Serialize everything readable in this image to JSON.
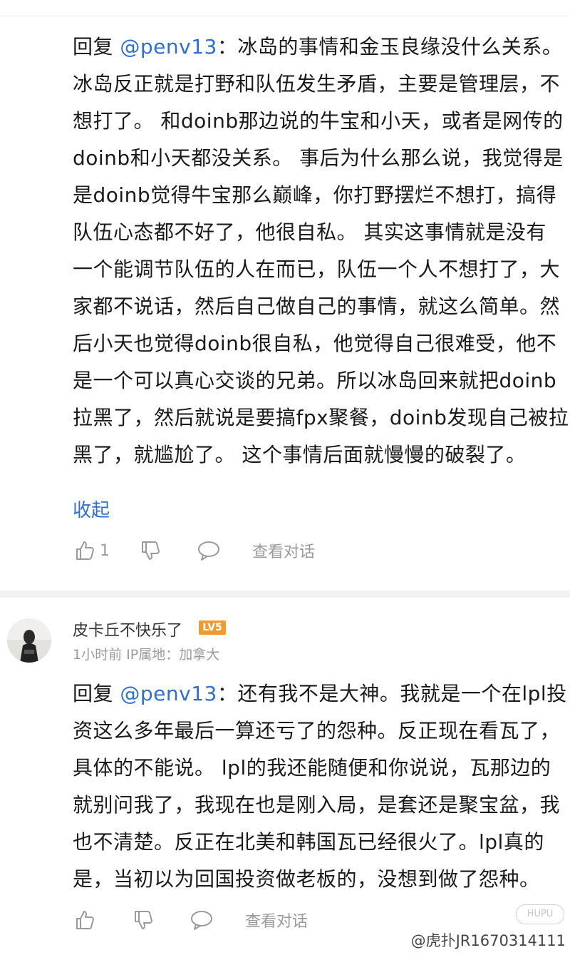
{
  "first_comment": {
    "lines": [
      {
        "pre": "回复 ",
        "mention": "@penv13",
        "post": "：冰岛的事情和金玉良缘没什么关系。"
      },
      {
        "pre": "冰岛反正就是打野和队伍发生矛盾，主要是管理层，不",
        "mention": "",
        "post": ""
      },
      {
        "pre": "想打了。 和doinb那边说的牛宝和小天，或者是网传的",
        "mention": "",
        "post": ""
      },
      {
        "pre": " doinb和小天都没关系。 事后为什么那么说，我觉得是",
        "mention": "",
        "post": ""
      },
      {
        "pre": "是doinb觉得牛宝那么巅峰，你打野摆烂不想打，搞得",
        "mention": "",
        "post": ""
      },
      {
        "pre": "队伍心态都不好了，他很自私。 其实这事情就是没有",
        "mention": "",
        "post": ""
      },
      {
        "pre": "一个能调节队伍的人在而已，队伍一个人不想打了，大",
        "mention": "",
        "post": ""
      },
      {
        "pre": "家都不说话，然后自己做自己的事情，就这么简单。然",
        "mention": "",
        "post": ""
      },
      {
        "pre": "后小天也觉得doinb很自私，他觉得自己很难受，他不",
        "mention": "",
        "post": ""
      },
      {
        "pre": "是一个可以真心交谈的兄弟。所以冰岛回来就把doinb",
        "mention": "",
        "post": ""
      },
      {
        "pre": "拉黑了，然后就说是要搞fpx聚餐，doinb发现自己被拉",
        "mention": "",
        "post": ""
      },
      {
        "pre": "黑了，就尴尬了。 这个事情后面就慢慢的破裂了。",
        "mention": "",
        "post": ""
      }
    ],
    "collapse_label": "收起",
    "like_count": "1",
    "view_conversation": "查看对话"
  },
  "second_comment": {
    "username": "皮卡丘不快乐了",
    "level_badge": "LV5",
    "meta": "1小时前  IP属地：加拿大",
    "lines": [
      {
        "pre": "回复 ",
        "mention": "@penv13",
        "post": "：还有我不是大神。我就是一个在lpl投"
      },
      {
        "pre": "资这么多年最后一算还亏了的怨种。反正现在看瓦了，",
        "mention": "",
        "post": ""
      },
      {
        "pre": "具体的不能说。 lpl的我还能随便和你说说，瓦那边的",
        "mention": "",
        "post": ""
      },
      {
        "pre": "就别问我了，我现在也是刚入局，是套还是聚宝盆，我",
        "mention": "",
        "post": ""
      },
      {
        "pre": "也不清楚。反正在北美和韩国瓦已经很火了。lpl真的",
        "mention": "",
        "post": ""
      },
      {
        "pre": "是，当初以为回国投资做老板的，没想到做了怨种。",
        "mention": "",
        "post": ""
      }
    ],
    "view_conversation": "查看对话"
  },
  "watermark": {
    "logo_text": "HUPU",
    "credit": "@虎扑JR1670314111"
  },
  "colors": {
    "mention": "#2f6fd1",
    "meta_gray": "#9a9a9a",
    "badge_orange": "#f29a2e"
  }
}
